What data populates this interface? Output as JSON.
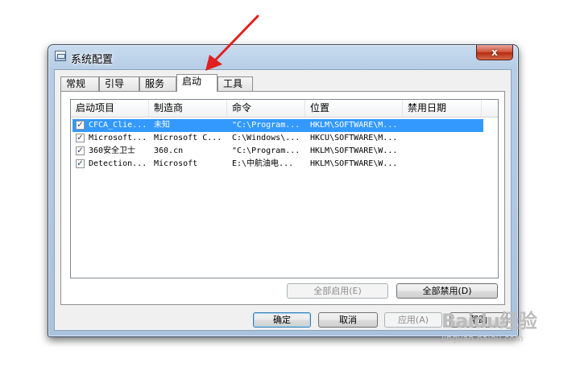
{
  "window": {
    "title": "系统配置",
    "close_symbol": "x",
    "accent_colors": {
      "selection": "#3399ff",
      "annotation_arrow": "#e02020"
    }
  },
  "tabs": [
    {
      "label": "常规"
    },
    {
      "label": "引导"
    },
    {
      "label": "服务"
    },
    {
      "label": "启动",
      "active": true
    },
    {
      "label": "工具"
    }
  ],
  "startup_list": {
    "columns": [
      "启动项目",
      "制造商",
      "命令",
      "位置",
      "禁用日期"
    ],
    "rows": [
      {
        "checked": true,
        "item": "CFCA_Clie...",
        "maker": "未知",
        "command": "\"C:\\Program...",
        "location": "HKLM\\SOFTWARE\\M...",
        "disabled_date": "",
        "selected": true
      },
      {
        "checked": true,
        "item": "Microsoft...",
        "maker": "Microsoft C...",
        "command": "C:\\Windows\\...",
        "location": "HKCU\\SOFTWARE\\M...",
        "disabled_date": ""
      },
      {
        "checked": true,
        "item": "360安全卫士",
        "maker": "360.cn",
        "command": "\"C:\\Program...",
        "location": "HKLM\\SOFTWARE\\W...",
        "disabled_date": ""
      },
      {
        "checked": true,
        "item": "Detection...",
        "maker": "Microsoft",
        "command": "E:\\中航油电...",
        "location": "HKLM\\SOFTWARE\\W...",
        "disabled_date": ""
      }
    ]
  },
  "panel_buttons": {
    "enable_all": "全部启用(E)",
    "disable_all": "全部禁用(D)"
  },
  "dialog_buttons": {
    "ok": "确定",
    "cancel": "取消",
    "apply": "应用(A)",
    "help": "帮助"
  },
  "watermark": {
    "logo": "Baidu经验",
    "url": "jingyan.baidu.com"
  }
}
